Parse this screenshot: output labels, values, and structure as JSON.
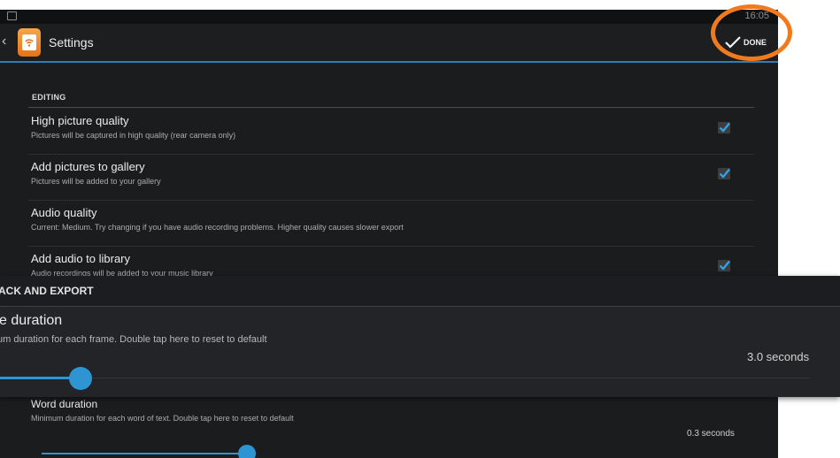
{
  "status_bar": {
    "time": "16:05"
  },
  "action_bar": {
    "title": "Settings",
    "done_label": "DONE"
  },
  "editing": {
    "header": "EDITING",
    "items": [
      {
        "title": "High picture quality",
        "summary": "Pictures will be captured in high quality (rear camera only)",
        "checked": true
      },
      {
        "title": "Add pictures to gallery",
        "summary": "Pictures will be added to your gallery",
        "checked": true
      },
      {
        "title": "Audio quality",
        "summary": "Current: Medium. Try changing if you have audio recording problems. Higher quality causes slower export"
      },
      {
        "title": "Add audio to library",
        "summary": "Audio recordings will be added to your music library",
        "checked": true
      }
    ]
  },
  "zoom_panel": {
    "header": "ACK AND EXPORT",
    "title": "e duration",
    "summary": "um duration for each frame. Double tap here to reset to default",
    "value": "3.0 seconds"
  },
  "word_duration": {
    "title": "Word duration",
    "summary": "Minimum duration for each word of text. Double tap here to reset to default",
    "value": "0.3 seconds"
  },
  "colors": {
    "accent": "#2f95d2",
    "highlight": "#f07a1e",
    "background": "#1b1c1e"
  }
}
